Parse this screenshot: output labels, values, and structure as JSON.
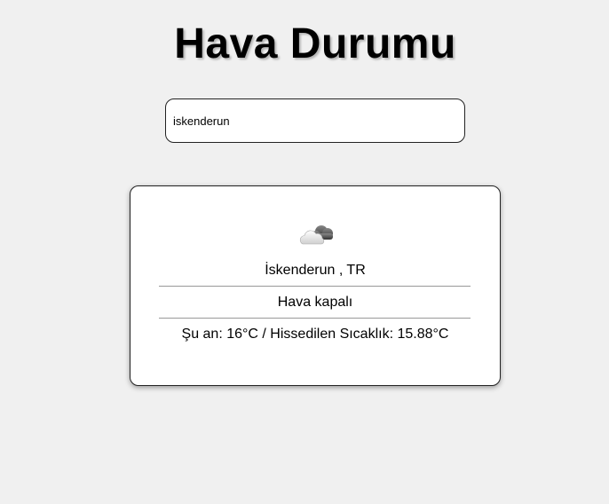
{
  "header": {
    "title": "Hava Durumu"
  },
  "search": {
    "value": "iskenderun"
  },
  "weather": {
    "icon": "cloud-icon",
    "location": "İskenderun , TR",
    "condition": "Hava kapalı",
    "temperature_text": "Şu an: 16°C / Hissedilen Sıcaklık: 15.88°C"
  }
}
